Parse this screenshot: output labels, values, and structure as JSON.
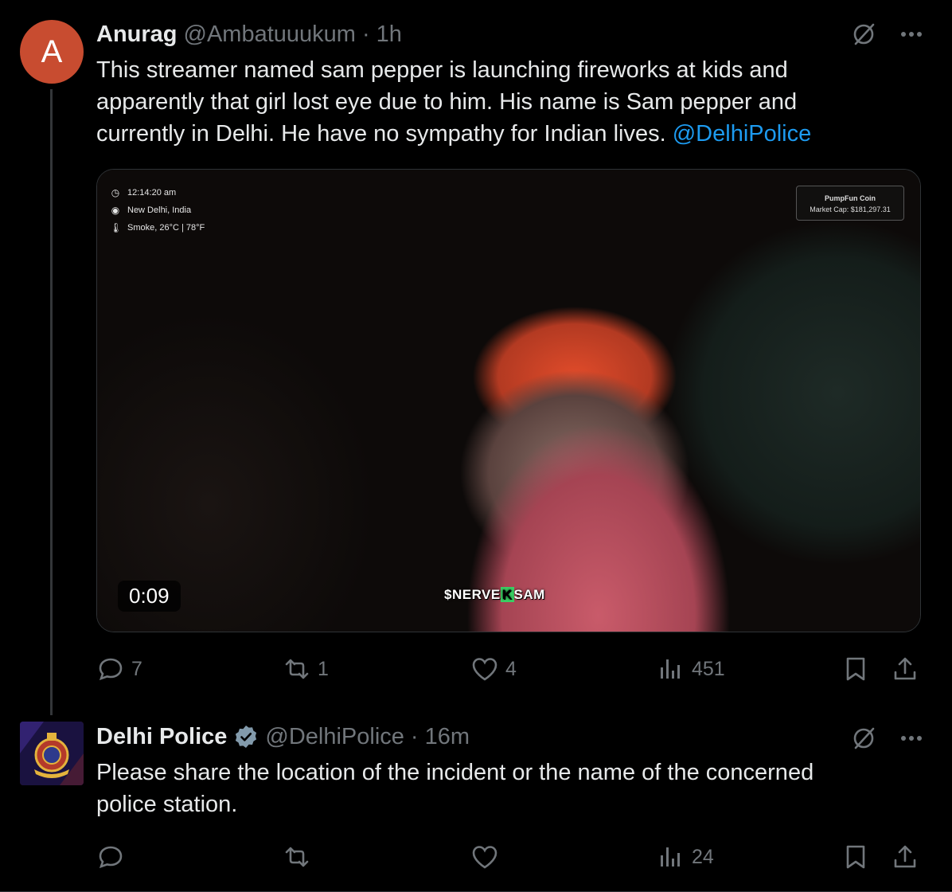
{
  "tweets": [
    {
      "avatar_letter": "A",
      "name": "Anurag",
      "handle": "@Ambatuuukum",
      "dot": "·",
      "time": "1h",
      "text_lines": [
        "This streamer named sam pepper is launching fireworks at kids and",
        "apparently that girl lost eye due to him. His name is Sam pepper  and",
        "currently in Delhi. He have no sympathy for Indian lives."
      ],
      "mention": "@DelhiPolice",
      "media": {
        "overlay_time": "12:14:20 am",
        "overlay_location": "New Delhi, India",
        "overlay_weather": "Smoke, 26°C | 78°F",
        "coin_title": "PumpFun Coin",
        "coin_cap": "Market Cap: $181,297.31",
        "duration": "0:09",
        "sticker_left": "$NERVE",
        "sticker_k": "K",
        "sticker_right": "SAM"
      },
      "stats": {
        "replies": "7",
        "reposts": "1",
        "likes": "4",
        "views": "451"
      }
    },
    {
      "name": "Delhi Police",
      "handle": "@DelhiPolice",
      "dot": "·",
      "time": "16m",
      "text_lines": [
        "Please share the location of the incident or the name of the concerned",
        "police station."
      ],
      "stats": {
        "replies": "",
        "reposts": "",
        "likes": "",
        "views": "24"
      }
    }
  ],
  "icons": {
    "grok": "grok-icon",
    "more": "more-icon",
    "reply": "reply-icon",
    "repost": "repost-icon",
    "like": "like-icon",
    "views": "views-icon",
    "bookmark": "bookmark-icon",
    "share": "share-icon",
    "verified": "verified-badge-icon"
  },
  "colors": {
    "accent": "#1d9bf0",
    "muted": "#71767b",
    "text": "#e7e9ea",
    "avatar_a": "#c84c30"
  }
}
